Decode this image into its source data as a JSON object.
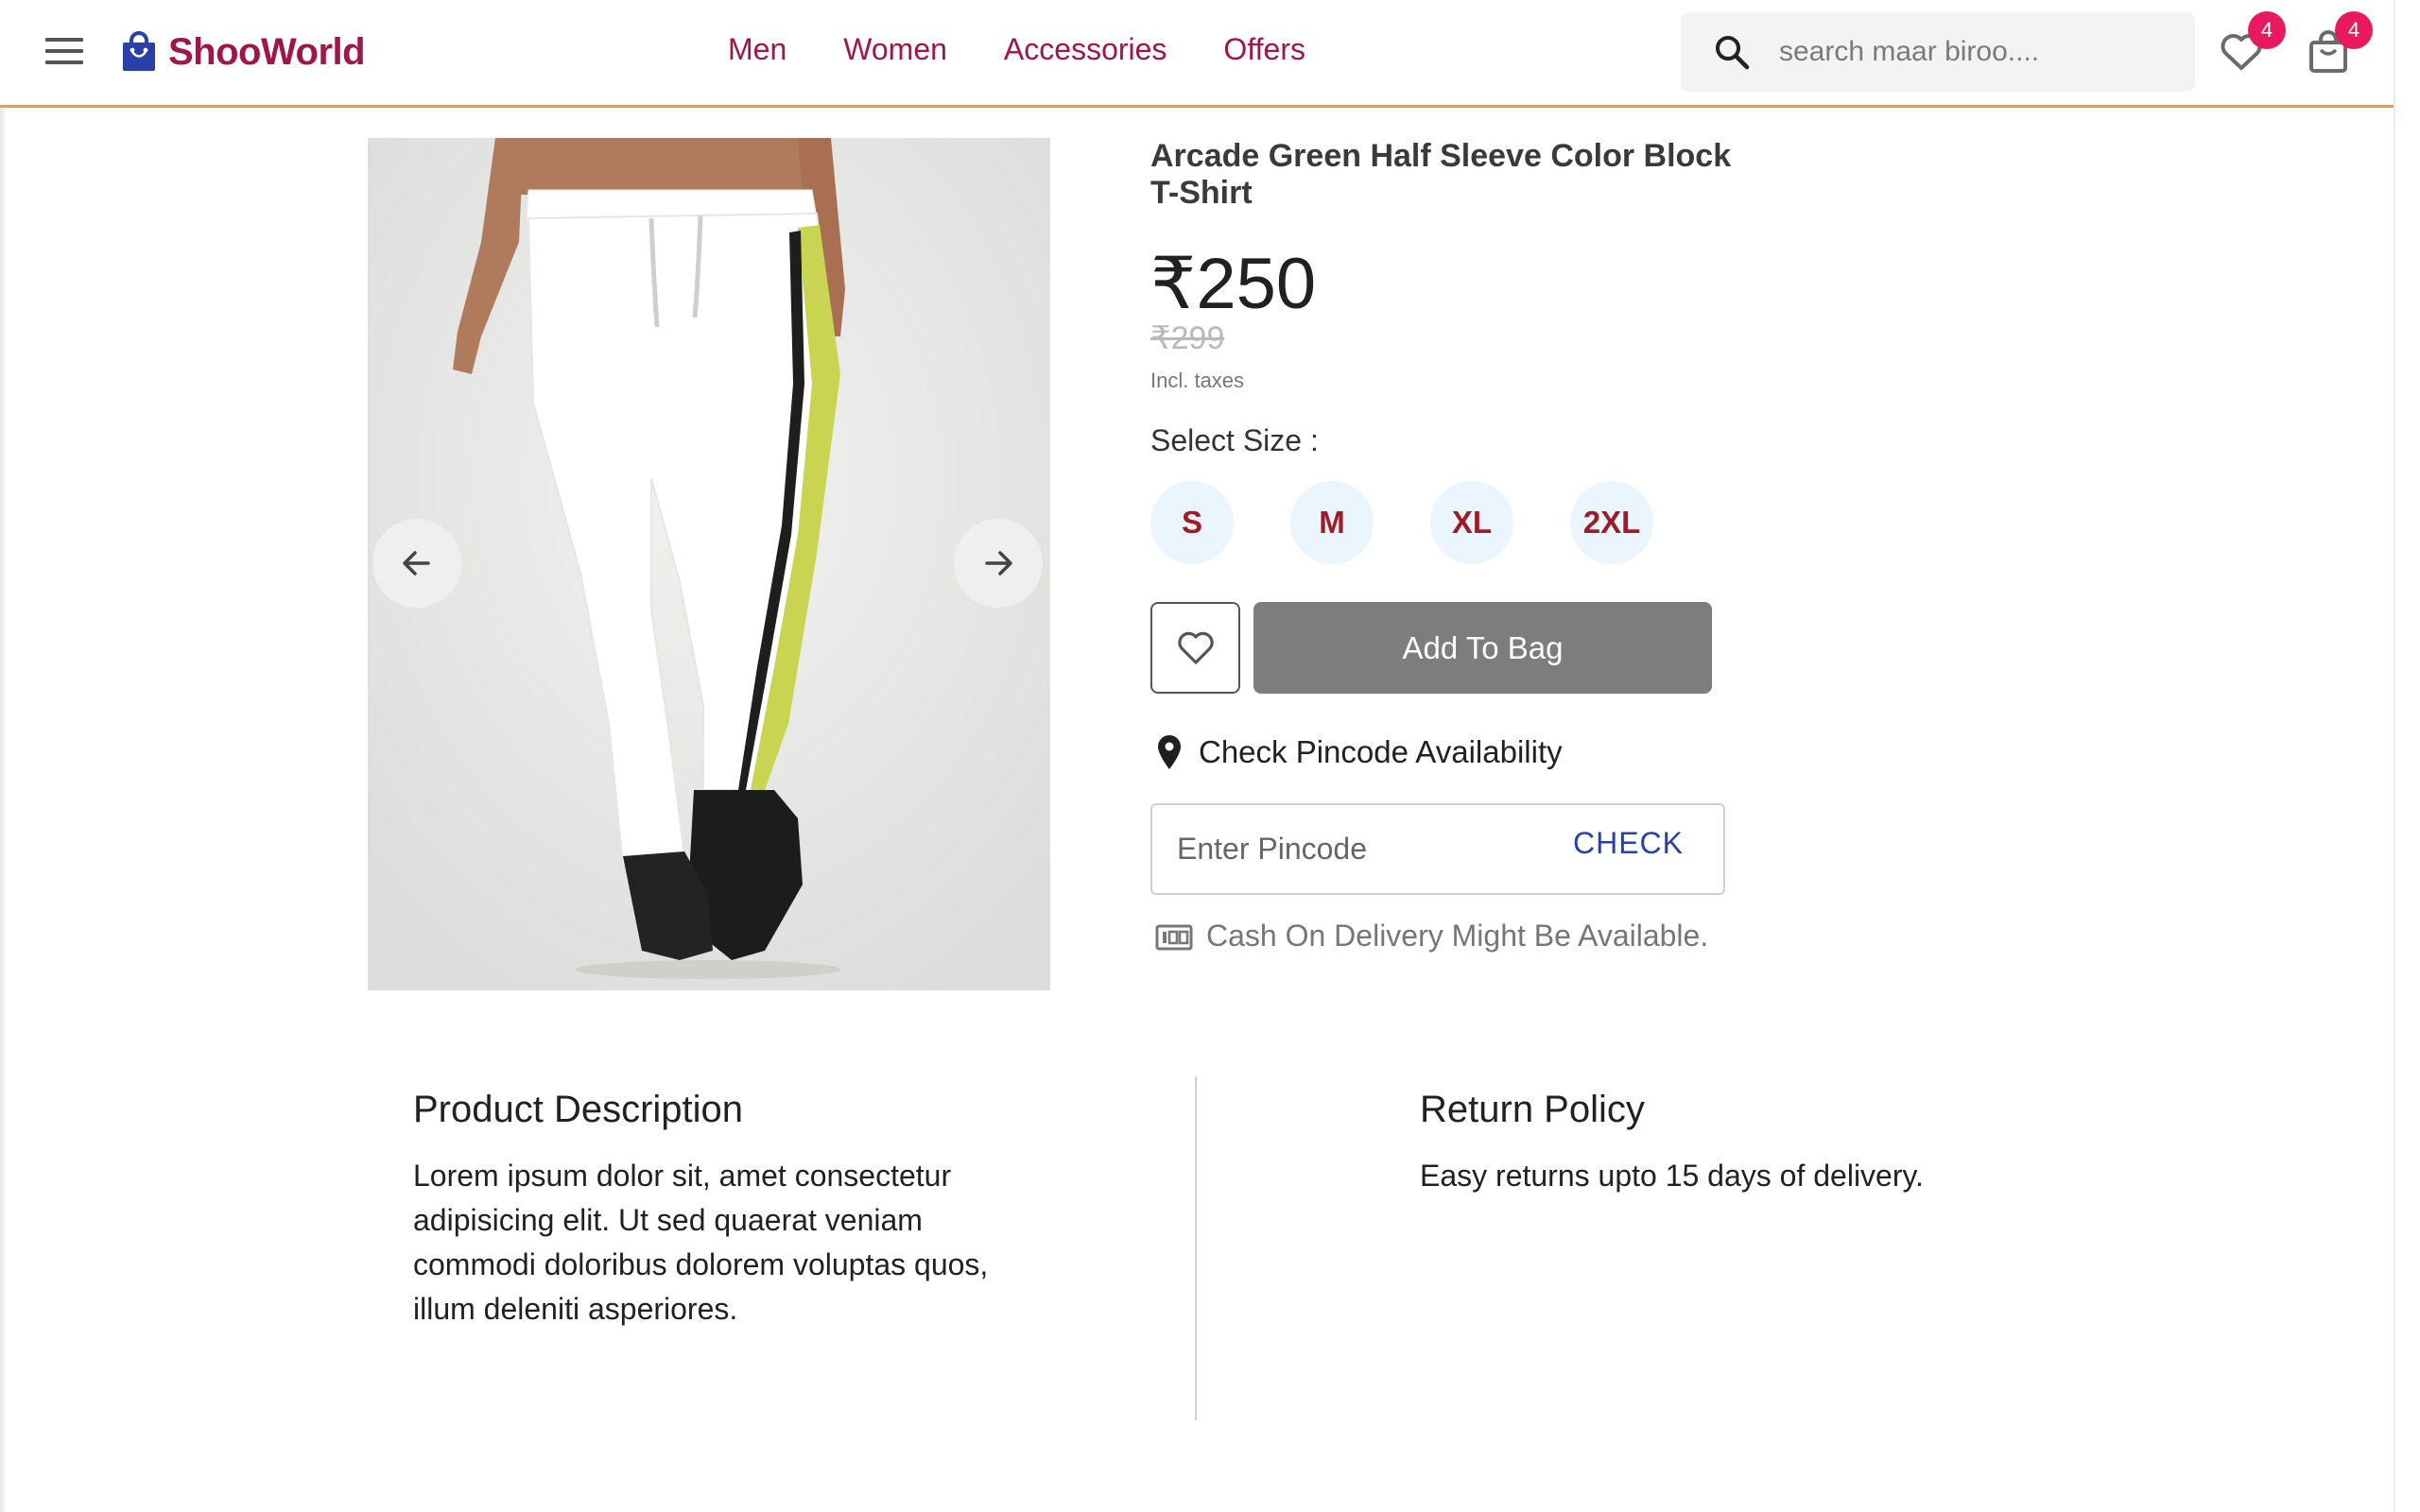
{
  "header": {
    "brand": "ShooWorld",
    "nav": [
      "Men",
      "Women",
      "Accessories",
      "Offers"
    ],
    "search_placeholder": "search maar biroo....",
    "wishlist_count": "4",
    "bag_count": "4",
    "accent_color": "#a0154c",
    "underline_color": "#f39a2b"
  },
  "product": {
    "title": "Arcade Green Half Sleeve Color Block T-Shirt",
    "price": "₹250",
    "mrp": "₹299",
    "taxes_note": "Incl. taxes",
    "size_label": "Select Size :",
    "sizes": [
      "S",
      "M",
      "XL",
      "2XL"
    ],
    "add_to_bag_label": "Add To Bag",
    "pincode_heading": "Check Pincode Availability",
    "pincode_placeholder": "Enter Pincode",
    "check_label": "CHECK",
    "cod_note": "Cash On Delivery Might Be Available."
  },
  "sections": {
    "description_title": "Product Description",
    "description_text": "Lorem ipsum dolor sit, amet consectetur adipisicing elit. Ut sed quaerat veniam commodi doloribus dolorem voluptas quos, illum deleniti asperiores.",
    "return_title": "Return Policy",
    "return_text": "Easy returns upto 15 days of delivery."
  }
}
